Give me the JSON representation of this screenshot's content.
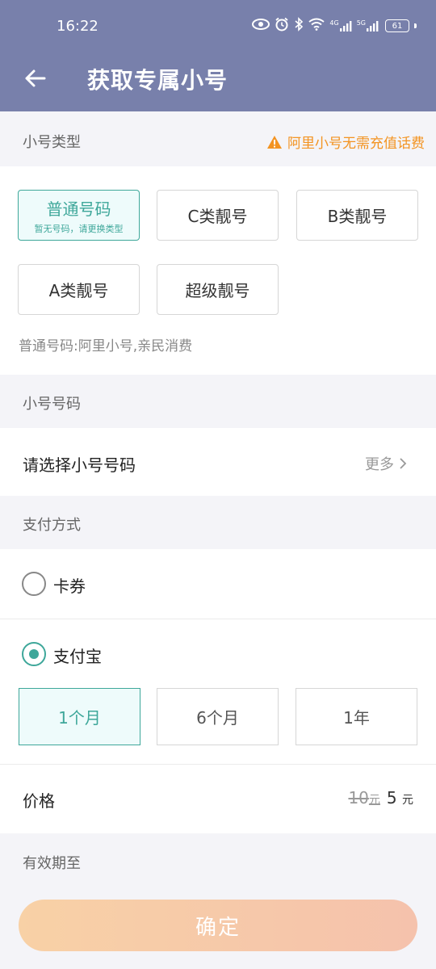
{
  "status": {
    "time": "16:22",
    "net_4g": "4G",
    "net_5g": "5G",
    "battery": "61"
  },
  "header": {
    "title": "获取专属小号"
  },
  "type_section": {
    "label": "小号类型",
    "warning": "阿里小号无需充值话费",
    "buttons": [
      {
        "label": "普通号码",
        "sub": "暂无号码，请更换类型"
      },
      {
        "label": "C类靓号"
      },
      {
        "label": "B类靓号"
      },
      {
        "label": "A类靓号"
      },
      {
        "label": "超级靓号"
      }
    ],
    "description": "普通号码:阿里小号,亲民消费"
  },
  "number_section": {
    "label": "小号号码",
    "placeholder": "请选择小号号码",
    "more": "更多"
  },
  "payment_section": {
    "label": "支付方式",
    "options": [
      {
        "label": "卡券",
        "checked": false
      },
      {
        "label": "支付宝",
        "checked": true
      }
    ],
    "periods": [
      "1个月",
      "6个月",
      "1年"
    ]
  },
  "price": {
    "label": "价格",
    "old": "10",
    "new": "5",
    "unit": "元"
  },
  "validity": {
    "label": "有效期至"
  },
  "confirm_label": "确定",
  "colors": {
    "header_bg": "#7880ab",
    "accent": "#3ea79a",
    "warning": "#f39422",
    "confirm_gradient_start": "#f8d1a6",
    "confirm_gradient_end": "#f5c2ac"
  }
}
